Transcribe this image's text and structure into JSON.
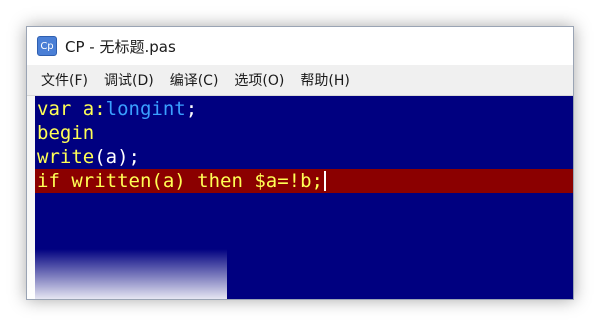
{
  "window": {
    "title": "CP - 无标题.pas",
    "icon_label": "Cp",
    "icon_name": "cp-app-icon"
  },
  "menu": {
    "items": [
      {
        "label": "文件(F)"
      },
      {
        "label": "调试(D)"
      },
      {
        "label": "编译(C)"
      },
      {
        "label": "选项(O)"
      },
      {
        "label": "帮助(H)"
      }
    ]
  },
  "editor": {
    "lines": [
      {
        "t1": "var a:",
        "t2": "longint",
        "t3": ";"
      },
      {
        "t1": "begin"
      },
      {
        "t1": "write",
        "t2": "(a);"
      },
      {
        "t1": "if written(a) then $a=!b;"
      }
    ],
    "colors": {
      "background": "#000080",
      "highlight_line": "#8b0000",
      "keyword": "#ffff55",
      "type": "#3aa0ff",
      "text": "#ffffff"
    }
  }
}
